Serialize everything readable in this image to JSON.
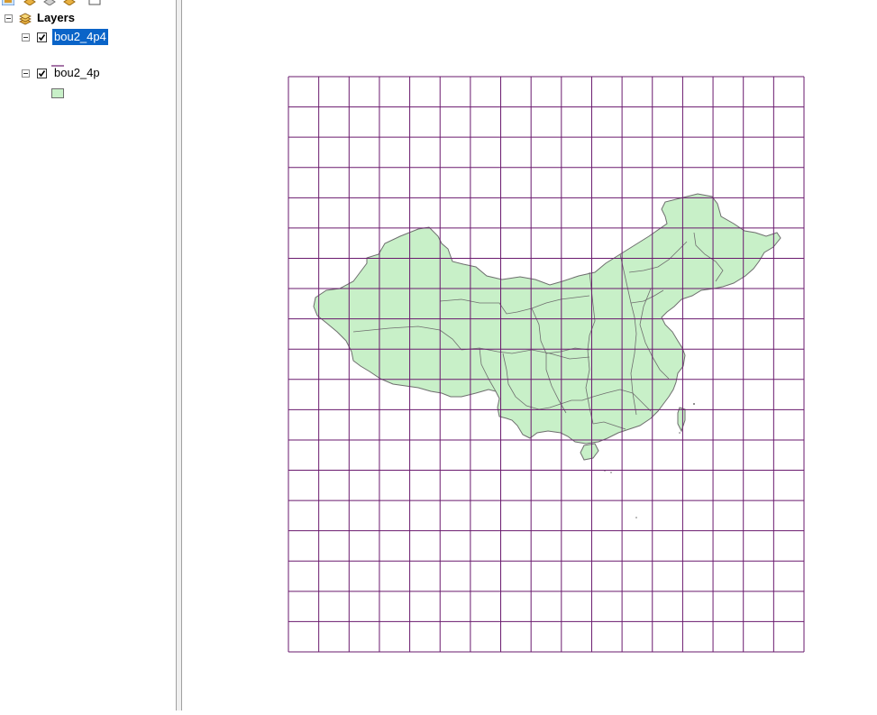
{
  "toc": {
    "toolbar": {
      "icons": [
        "list-by-drawing-order-icon",
        "list-by-source-icon",
        "list-by-visibility-icon",
        "list-by-selection-icon",
        "options-icon"
      ]
    },
    "root": {
      "label": "Layers",
      "icon": "layers-icon"
    },
    "layers": [
      {
        "name": "bou2_4p4",
        "checked": true,
        "selected": true,
        "symbol": "line",
        "symbol_color": "#6a1a6e"
      },
      {
        "name": "bou2_4p",
        "checked": true,
        "selected": false,
        "symbol": "polygon",
        "symbol_fill": "#c8f0c8",
        "symbol_stroke": "#6e6e6e"
      }
    ]
  },
  "map": {
    "grid_color": "#6a1a6e",
    "polygon_fill": "#c8f0c8",
    "polygon_stroke": "#6e6e6e"
  }
}
